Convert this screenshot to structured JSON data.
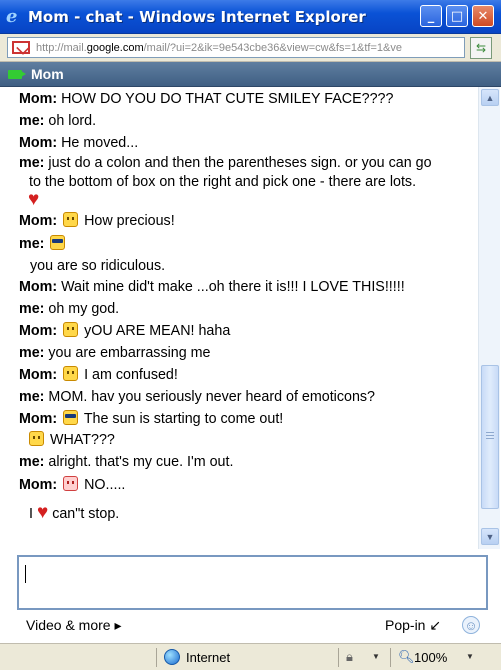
{
  "window": {
    "title": "Mom - chat - Windows Internet Explorer",
    "minimize": "_",
    "maximize": "□",
    "close": "✕"
  },
  "address": {
    "prefix": "http://mail.",
    "domain": "google.com",
    "path": "/mail/?ui=2&ik=9e543cbe36&view=cw&fs=1&tf=1&ve"
  },
  "chat": {
    "contact": "Mom",
    "messages": [
      {
        "speaker": "Mom:",
        "text": " HOW DO YOU DO THAT CUTE SMILEY FACE????"
      },
      {
        "speaker": "me:",
        "text": " oh lord."
      },
      {
        "speaker": "Mom:",
        "text": " He moved..."
      },
      {
        "speaker": "me:",
        "text": " just do a colon and then the parentheses sign.  or you can go"
      },
      {
        "speaker": "",
        "text": "to the bottom of box on the right and pick one - there are lots."
      },
      {
        "speaker": "Mom:",
        "text": " How precious!"
      },
      {
        "speaker": "me:",
        "text": ""
      },
      {
        "speaker": "",
        "text": "you are so ridiculous."
      },
      {
        "speaker": "Mom:",
        "text": " Wait mine did't make ...oh there it is!!! I LOVE THIS!!!!!"
      },
      {
        "speaker": "me:",
        "text": " oh my god."
      },
      {
        "speaker": "Mom:",
        "text": " yOU ARE MEAN! haha"
      },
      {
        "speaker": "me:",
        "text": " you are embarrassing me"
      },
      {
        "speaker": "Mom:",
        "text": " I am confused!"
      },
      {
        "speaker": "me:",
        "text": " MOM.  hav you seriously never heard of emoticons?"
      },
      {
        "speaker": "Mom:",
        "text": " The sun is starting to come out!"
      },
      {
        "speaker": "",
        "text": " WHAT???"
      },
      {
        "speaker": "me:",
        "text": " alright. that's my cue.  I'm out."
      },
      {
        "speaker": "Mom:",
        "text": " NO....."
      },
      {
        "speaker": "",
        "text_before": "I ",
        "text_after": " can\"t stop."
      }
    ]
  },
  "input": {
    "value": ""
  },
  "footer": {
    "video_more": "Video & more ▸",
    "pop_in": "Pop-in ↙"
  },
  "status": {
    "zone": "Internet",
    "zoom": "100%"
  },
  "icons": {
    "heart": "♥",
    "smiley": "☺",
    "scroll_up": "▲",
    "scroll_down": "▼",
    "go": "⇆",
    "lock": "🔒︎",
    "zoom": "🔍︎",
    "dropdown": "▼"
  }
}
